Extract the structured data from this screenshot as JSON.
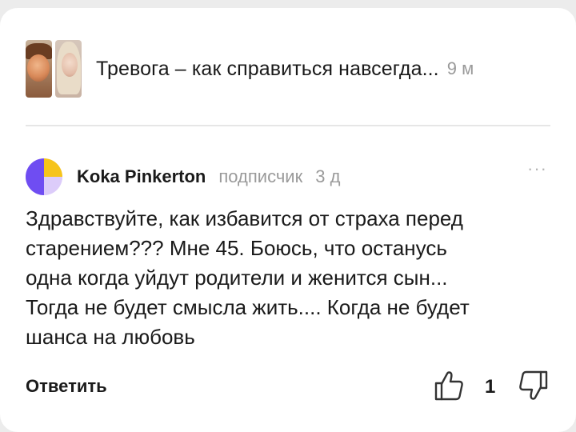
{
  "video": {
    "title": "Тревога – как справиться навсегда...",
    "age": "9 м"
  },
  "comment": {
    "author": "Koka Pinkerton",
    "role": "подписчик",
    "ago": "3 д",
    "lines": [
      "Здравствуйте, как избавится от страха перед",
      "старением??? Мне 45. Боюсь, что останусь",
      "одна когда уйдут родители и женится сын...",
      "Тогда не будет смысла жить.... Когда не будет",
      "шанса на любовь"
    ],
    "more_label": "···"
  },
  "actions": {
    "reply_label": "Ответить",
    "like_count": "1",
    "like_icon": "thumbs-up-icon",
    "dislike_icon": "thumbs-down-icon"
  },
  "colors": {
    "avatar_purple": "#6f4df2",
    "avatar_yellow": "#f6c41b",
    "avatar_lavender": "#dcccfa",
    "muted_text": "#9a9a9a"
  }
}
